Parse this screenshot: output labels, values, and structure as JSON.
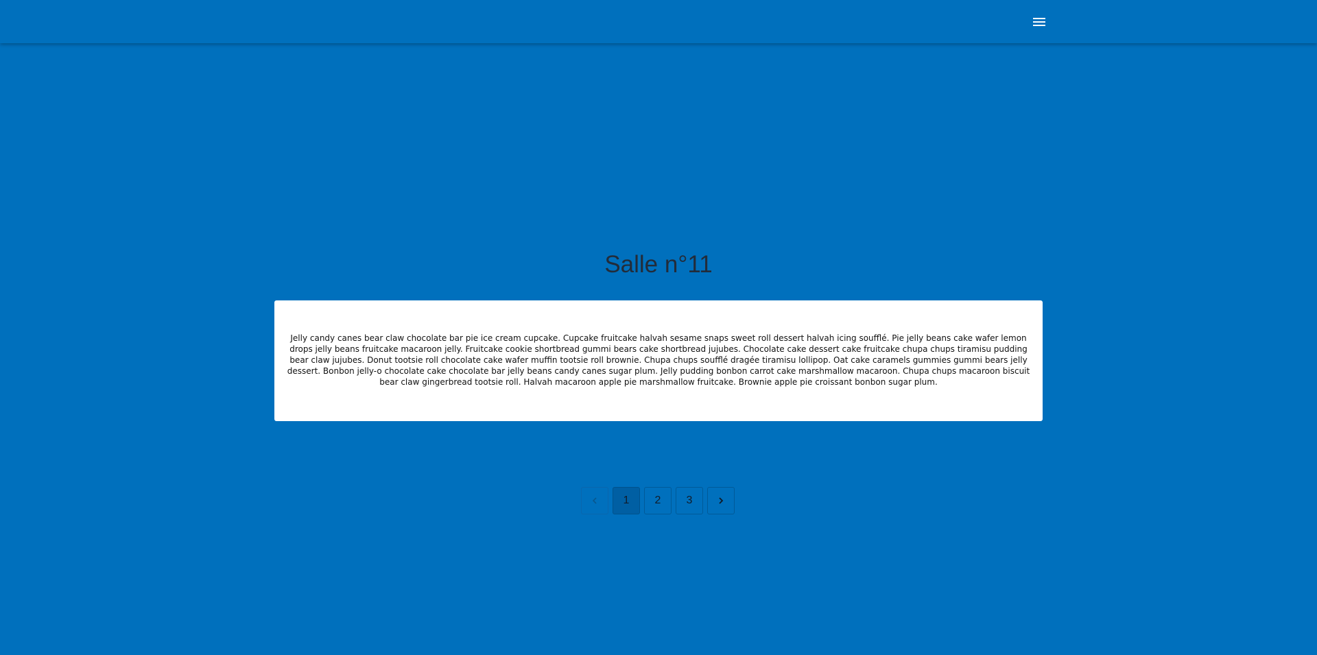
{
  "header": {
    "menu_icon": "menu-icon"
  },
  "main": {
    "title": "Salle n°11",
    "body_text": "Jelly candy canes bear claw chocolate bar pie ice cream cupcake. Cupcake fruitcake halvah sesame snaps sweet roll dessert halvah icing soufflé. Pie jelly beans cake wafer lemon drops jelly beans fruitcake macaroon jelly. Fruitcake cookie shortbread gummi bears cake shortbread jujubes. Chocolate cake dessert cake fruitcake chupa chups tiramisu pudding bear claw jujubes. Donut tootsie roll chocolate cake wafer muffin tootsie roll brownie. Chupa chups soufflé dragée tiramisu lollipop. Oat cake caramels gummies gummi bears jelly dessert. Bonbon jelly-o chocolate cake chocolate bar jelly beans candy canes sugar plum. Jelly pudding bonbon carrot cake marshmallow macaroon. Chupa chups macaroon biscuit bear claw gingerbread tootsie roll. Halvah macaroon apple pie marshmallow fruitcake. Brownie apple pie croissant bonbon sugar plum."
  },
  "pagination": {
    "prev_icon": "chevron-left-icon",
    "next_icon": "chevron-right-icon",
    "pages": [
      "1",
      "2",
      "3"
    ],
    "current_page": "1"
  },
  "colors": {
    "background": "#0070bd",
    "card": "#ffffff",
    "title_text": "#222c3a"
  }
}
